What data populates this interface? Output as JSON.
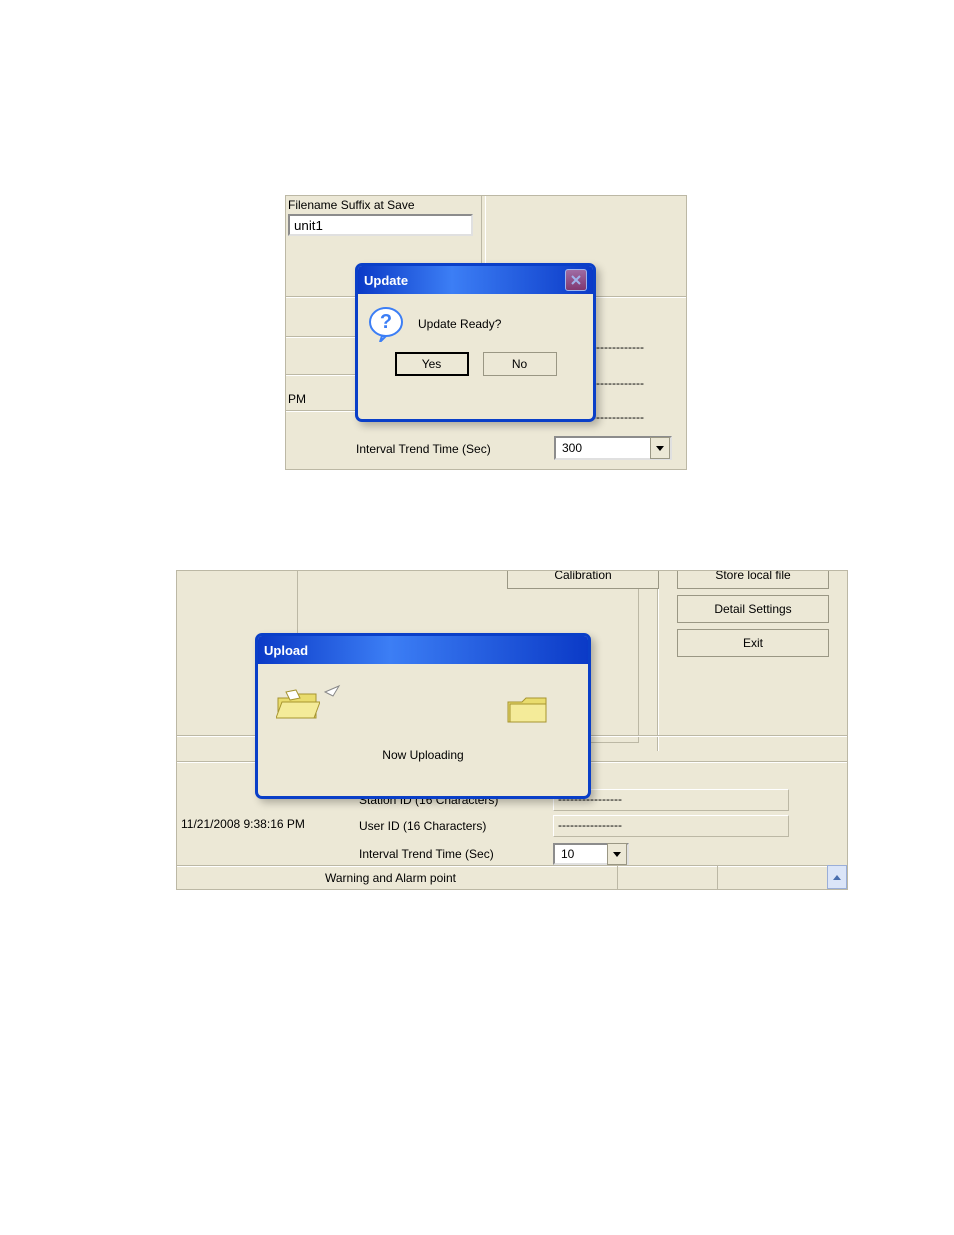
{
  "top": {
    "suffix_label": "Filename Suffix at Save",
    "suffix_value": "unit1",
    "pm": "PM",
    "trend_label": "Interval Trend Time (Sec)",
    "trend_value": "300",
    "dashes": "-------------"
  },
  "update_dialog": {
    "title": "Update",
    "message": "Update Ready?",
    "yes": "Yes",
    "no": "No"
  },
  "bottom": {
    "calibration_btn": "Calibration",
    "store_btn": "Store local file",
    "detail_btn": "Detail Settings",
    "exit_btn": "Exit",
    "timestamp": "11/21/2008 9:38:16 PM",
    "station_label": "Station ID (16 Characters)",
    "user_label": "User ID (16 Characters)",
    "interval_label": "Interval Trend Time (Sec)",
    "station_value": "----------------",
    "user_value": "----------------",
    "dash_above": "--------",
    "interval_value": "10",
    "footer": "Warning and Alarm point"
  },
  "upload_dialog": {
    "title": "Upload",
    "message": "Now Uploading"
  }
}
